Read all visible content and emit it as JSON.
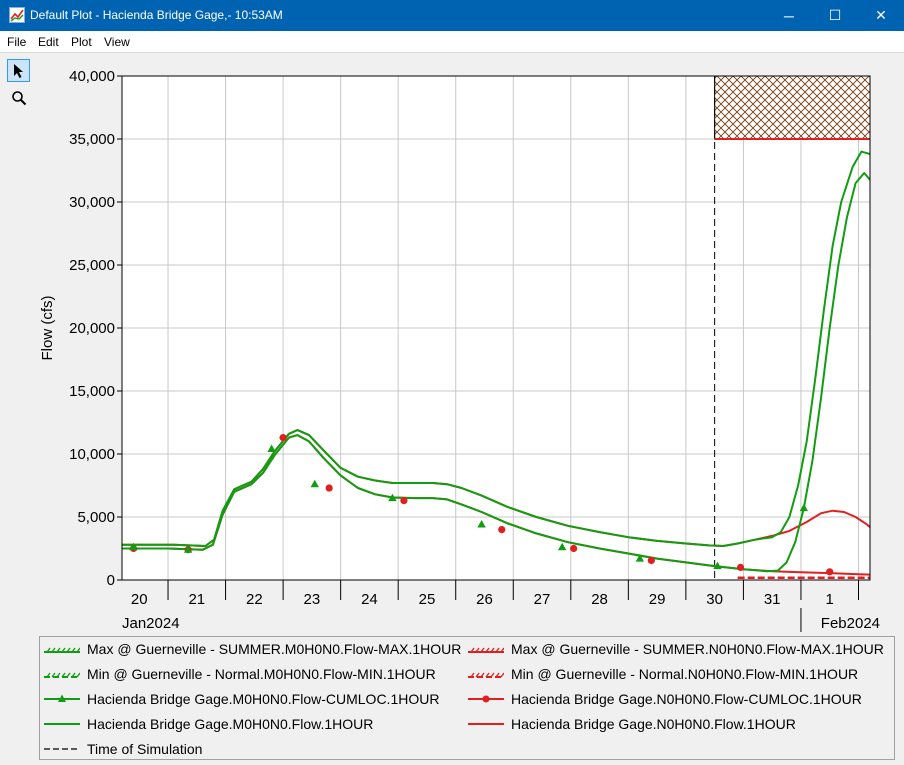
{
  "window": {
    "title": "Default Plot - Hacienda Bridge Gage,- 10:53AM",
    "minimize_glyph": "─",
    "maximize_glyph": "☐",
    "close_glyph": "✕"
  },
  "menu": [
    "File",
    "Edit",
    "Plot",
    "View"
  ],
  "tools": [
    {
      "name": "pointer",
      "icon": "arrow-pointer-icon"
    },
    {
      "name": "zoom",
      "icon": "magnifier-icon"
    }
  ],
  "colors": {
    "green": "#119d11",
    "red": "#e02020",
    "hatch": "#7a3b10"
  },
  "chart_data": {
    "type": "line",
    "ylabel": "Flow (cfs)",
    "ylim": [
      0,
      40000
    ],
    "yticks": [
      0,
      5000,
      10000,
      15000,
      20000,
      25000,
      30000,
      35000,
      40000
    ],
    "ytick_labels": [
      "0",
      "5,000",
      "10,000",
      "15,000",
      "20,000",
      "25,000",
      "30,000",
      "35,000",
      "40,000"
    ],
    "xlim": [
      19.7,
      32.7
    ],
    "x_unit": "day (Jan 2024, 32 = Feb 1)",
    "x_day_labels": [
      "20",
      "21",
      "22",
      "23",
      "24",
      "25",
      "26",
      "27",
      "28",
      "29",
      "30",
      "31",
      "1"
    ],
    "x_month_labels": [
      "Jan2024",
      "Feb2024"
    ],
    "grid": true,
    "time_of_simulation": 30.0,
    "max_flow_band": {
      "from": 35000,
      "to": 40000,
      "start": 30.0
    },
    "series": [
      {
        "name": "Hacienda Bridge Gage.N0H0N0.Flow.1HOUR",
        "color": "#e02020",
        "points": [
          [
            19.7,
            2800
          ],
          [
            20.6,
            2800
          ],
          [
            21.15,
            2700
          ],
          [
            21.3,
            3200
          ],
          [
            21.45,
            5500
          ],
          [
            21.65,
            7200
          ],
          [
            21.95,
            7800
          ],
          [
            22.15,
            8800
          ],
          [
            22.35,
            10200
          ],
          [
            22.6,
            11600
          ],
          [
            22.75,
            11900
          ],
          [
            22.95,
            11500
          ],
          [
            23.2,
            10300
          ],
          [
            23.5,
            8900
          ],
          [
            23.8,
            8200
          ],
          [
            24.1,
            7900
          ],
          [
            24.4,
            7700
          ],
          [
            24.75,
            7700
          ],
          [
            25.1,
            7700
          ],
          [
            25.35,
            7600
          ],
          [
            25.6,
            7300
          ],
          [
            25.95,
            6700
          ],
          [
            26.4,
            5800
          ],
          [
            26.9,
            5000
          ],
          [
            27.45,
            4300
          ],
          [
            28.0,
            3800
          ],
          [
            28.5,
            3400
          ],
          [
            29.0,
            3100
          ],
          [
            29.5,
            2900
          ],
          [
            29.9,
            2750
          ],
          [
            30.15,
            2700
          ],
          [
            30.4,
            2900
          ],
          [
            30.7,
            3200
          ],
          [
            31.0,
            3500
          ],
          [
            31.3,
            3900
          ],
          [
            31.6,
            4600
          ],
          [
            31.85,
            5300
          ],
          [
            32.05,
            5500
          ],
          [
            32.25,
            5400
          ],
          [
            32.45,
            5000
          ],
          [
            32.65,
            4400
          ],
          [
            32.85,
            3600
          ],
          [
            32.95,
            3200
          ]
        ]
      },
      {
        "name": "Hacienda Bridge Gage.N0H0N0.Flow-CUMLOC.1HOUR",
        "color": "#e02020",
        "marker": "circle",
        "points": [
          [
            19.7,
            2500
          ],
          [
            20.5,
            2500
          ],
          [
            21.1,
            2400
          ],
          [
            21.28,
            2800
          ],
          [
            21.45,
            5200
          ],
          [
            21.65,
            7000
          ],
          [
            21.95,
            7600
          ],
          [
            22.15,
            8500
          ],
          [
            22.35,
            9900
          ],
          [
            22.6,
            11300
          ],
          [
            22.75,
            11500
          ],
          [
            22.95,
            11000
          ],
          [
            23.2,
            9700
          ],
          [
            23.5,
            8300
          ],
          [
            23.8,
            7300
          ],
          [
            24.1,
            6800
          ],
          [
            24.4,
            6550
          ],
          [
            24.8,
            6500
          ],
          [
            25.1,
            6500
          ],
          [
            25.35,
            6400
          ],
          [
            25.6,
            6000
          ],
          [
            25.95,
            5400
          ],
          [
            26.4,
            4500
          ],
          [
            26.9,
            3700
          ],
          [
            27.45,
            3000
          ],
          [
            28.0,
            2500
          ],
          [
            28.5,
            2100
          ],
          [
            29.0,
            1700
          ],
          [
            29.5,
            1400
          ],
          [
            30.0,
            1100
          ],
          [
            30.5,
            850
          ],
          [
            31.0,
            700
          ],
          [
            31.5,
            620
          ],
          [
            32.0,
            550
          ],
          [
            32.5,
            450
          ],
          [
            32.95,
            400
          ]
        ],
        "markers": [
          [
            19.9,
            2500
          ],
          [
            20.85,
            2400
          ],
          [
            22.5,
            11300
          ],
          [
            23.3,
            7300
          ],
          [
            24.6,
            6300
          ],
          [
            26.3,
            4000
          ],
          [
            27.55,
            2500
          ],
          [
            28.9,
            1550
          ],
          [
            30.45,
            1000
          ],
          [
            32.0,
            650
          ]
        ]
      },
      {
        "name": "Hacienda Bridge Gage.M0H0N0.Flow.1HOUR",
        "color": "#119d11",
        "points": [
          [
            19.7,
            2800
          ],
          [
            20.6,
            2800
          ],
          [
            21.15,
            2700
          ],
          [
            21.3,
            3200
          ],
          [
            21.45,
            5500
          ],
          [
            21.65,
            7200
          ],
          [
            21.95,
            7800
          ],
          [
            22.15,
            8800
          ],
          [
            22.35,
            10200
          ],
          [
            22.6,
            11600
          ],
          [
            22.75,
            11900
          ],
          [
            22.95,
            11500
          ],
          [
            23.2,
            10300
          ],
          [
            23.5,
            8900
          ],
          [
            23.8,
            8200
          ],
          [
            24.1,
            7900
          ],
          [
            24.4,
            7700
          ],
          [
            24.75,
            7700
          ],
          [
            25.1,
            7700
          ],
          [
            25.35,
            7600
          ],
          [
            25.6,
            7300
          ],
          [
            25.95,
            6700
          ],
          [
            26.4,
            5800
          ],
          [
            26.9,
            5000
          ],
          [
            27.45,
            4300
          ],
          [
            28.0,
            3800
          ],
          [
            28.5,
            3400
          ],
          [
            29.0,
            3100
          ],
          [
            29.5,
            2900
          ],
          [
            29.9,
            2750
          ],
          [
            30.15,
            2700
          ],
          [
            30.4,
            2900
          ],
          [
            30.7,
            3200
          ],
          [
            31.0,
            3400
          ],
          [
            31.15,
            3800
          ],
          [
            31.3,
            5000
          ],
          [
            31.45,
            7500
          ],
          [
            31.6,
            11000
          ],
          [
            31.75,
            16000
          ],
          [
            31.9,
            21500
          ],
          [
            32.05,
            26500
          ],
          [
            32.2,
            30000
          ],
          [
            32.4,
            32800
          ],
          [
            32.55,
            34000
          ],
          [
            32.7,
            33800
          ],
          [
            32.85,
            32000
          ],
          [
            32.95,
            30500
          ]
        ]
      },
      {
        "name": "Hacienda Bridge Gage.M0H0N0.Flow-CUMLOC.1HOUR",
        "color": "#119d11",
        "marker": "triangle",
        "points": [
          [
            19.7,
            2500
          ],
          [
            20.5,
            2500
          ],
          [
            21.1,
            2400
          ],
          [
            21.28,
            2800
          ],
          [
            21.45,
            5200
          ],
          [
            21.65,
            7000
          ],
          [
            21.95,
            7600
          ],
          [
            22.15,
            8500
          ],
          [
            22.35,
            9900
          ],
          [
            22.6,
            11300
          ],
          [
            22.75,
            11500
          ],
          [
            22.95,
            11000
          ],
          [
            23.2,
            9700
          ],
          [
            23.5,
            8300
          ],
          [
            23.8,
            7300
          ],
          [
            24.1,
            6800
          ],
          [
            24.4,
            6550
          ],
          [
            24.8,
            6500
          ],
          [
            25.1,
            6500
          ],
          [
            25.35,
            6400
          ],
          [
            25.6,
            6000
          ],
          [
            25.95,
            5400
          ],
          [
            26.4,
            4500
          ],
          [
            26.9,
            3700
          ],
          [
            27.45,
            3000
          ],
          [
            28.0,
            2500
          ],
          [
            28.5,
            2100
          ],
          [
            29.0,
            1700
          ],
          [
            29.5,
            1400
          ],
          [
            30.0,
            1100
          ],
          [
            30.5,
            850
          ],
          [
            30.9,
            700
          ],
          [
            31.1,
            750
          ],
          [
            31.25,
            1400
          ],
          [
            31.4,
            3000
          ],
          [
            31.55,
            5700
          ],
          [
            31.7,
            9500
          ],
          [
            31.85,
            14500
          ],
          [
            32.0,
            20000
          ],
          [
            32.15,
            25000
          ],
          [
            32.3,
            28800
          ],
          [
            32.45,
            31500
          ],
          [
            32.6,
            32300
          ],
          [
            32.75,
            31500
          ],
          [
            32.9,
            28500
          ],
          [
            32.95,
            27000
          ]
        ],
        "markers": [
          [
            19.9,
            2600
          ],
          [
            20.85,
            2400
          ],
          [
            22.3,
            10400
          ],
          [
            23.05,
            7600
          ],
          [
            24.4,
            6500
          ],
          [
            25.95,
            4400
          ],
          [
            27.35,
            2600
          ],
          [
            28.7,
            1700
          ],
          [
            30.05,
            1100
          ],
          [
            31.55,
            5700
          ],
          [
            32.85,
            29500
          ]
        ]
      },
      {
        "name": "Max @ Guerneville - SUMMER.N0H0N0.Flow-MAX.1HOUR",
        "color": "#e02020",
        "level": 35000,
        "from": 30.0
      },
      {
        "name": "Min @ Guerneville - Normal.N0H0N0.Flow-MIN.1HOUR",
        "color": "#e02020",
        "level": 100,
        "from": 30.4
      }
    ]
  },
  "legend": [
    {
      "label": "Max @ Guerneville - SUMMER.M0H0N0.Flow-MAX.1HOUR",
      "color": "#119d11",
      "style": "hatch"
    },
    {
      "label": "Max @ Guerneville - SUMMER.N0H0N0.Flow-MAX.1HOUR",
      "color": "#e02020",
      "style": "hatch"
    },
    {
      "label": "Min @ Guerneville - Normal.M0H0N0.Flow-MIN.1HOUR",
      "color": "#119d11",
      "style": "dash-hatch"
    },
    {
      "label": "Min @ Guerneville - Normal.N0H0N0.Flow-MIN.1HOUR",
      "color": "#e02020",
      "style": "dash-hatch"
    },
    {
      "label": "Hacienda Bridge Gage.M0H0N0.Flow-CUMLOC.1HOUR",
      "color": "#119d11",
      "style": "triangle"
    },
    {
      "label": "Hacienda Bridge Gage.N0H0N0.Flow-CUMLOC.1HOUR",
      "color": "#e02020",
      "style": "circle"
    },
    {
      "label": "Hacienda Bridge Gage.M0H0N0.Flow.1HOUR",
      "color": "#119d11",
      "style": "line"
    },
    {
      "label": "Hacienda Bridge Gage.N0H0N0.Flow.1HOUR",
      "color": "#e02020",
      "style": "line"
    },
    {
      "label": "Time of Simulation",
      "color": "#000000",
      "style": "dashed"
    }
  ]
}
